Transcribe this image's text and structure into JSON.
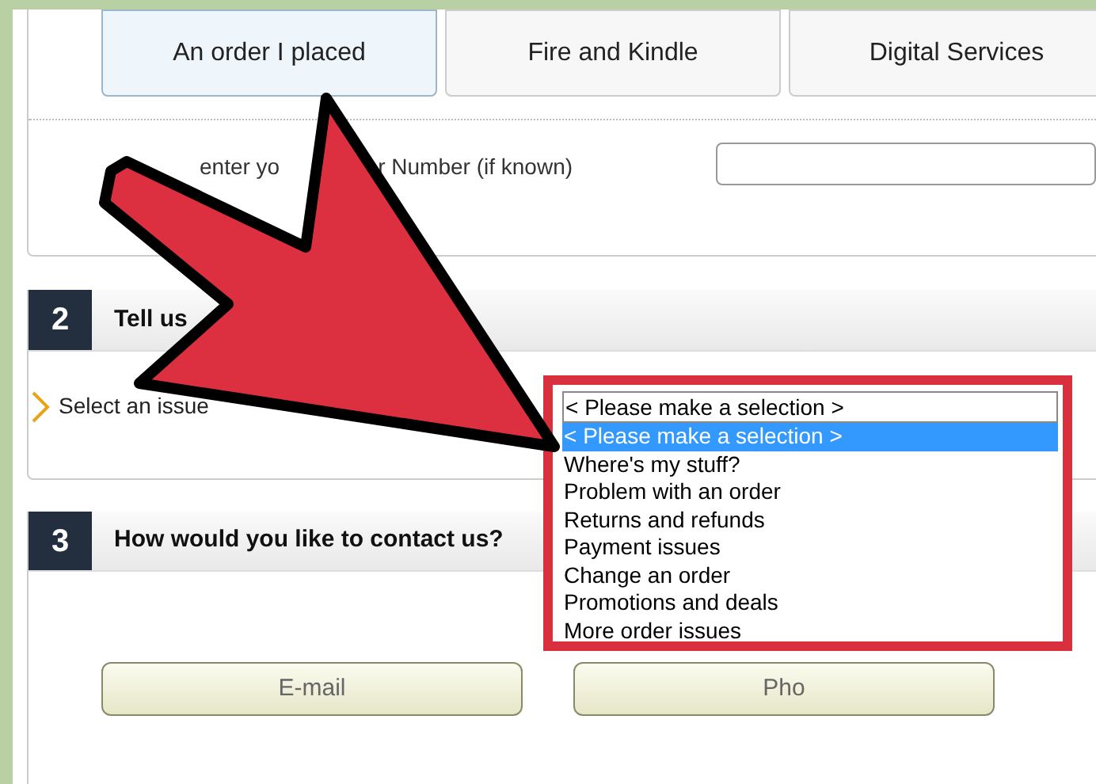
{
  "tabs": [
    {
      "label": "An order I placed",
      "selected": true
    },
    {
      "label": "Fire and Kindle",
      "selected": false
    },
    {
      "label": "Digital Services",
      "selected": false
    }
  ],
  "order_row": {
    "label_parts": [
      "enter yo",
      "r Number (if known)"
    ]
  },
  "section_2": {
    "number": "2",
    "title": "Tell us",
    "issue_label": "Select an issue",
    "select_value": "< Please make a selection >",
    "options": [
      {
        "label": "< Please make a selection >",
        "selected": true
      },
      {
        "label": "Where's my stuff?",
        "selected": false
      },
      {
        "label": "Problem with an order",
        "selected": false
      },
      {
        "label": "Returns and refunds",
        "selected": false
      },
      {
        "label": "Payment issues",
        "selected": false
      },
      {
        "label": "Change an order",
        "selected": false
      },
      {
        "label": "Promotions and deals",
        "selected": false
      },
      {
        "label": "More order issues",
        "selected": false
      }
    ]
  },
  "section_3": {
    "number": "3",
    "title": "How would you like to contact us?",
    "buttons": [
      "E-mail",
      "Pho"
    ]
  }
}
